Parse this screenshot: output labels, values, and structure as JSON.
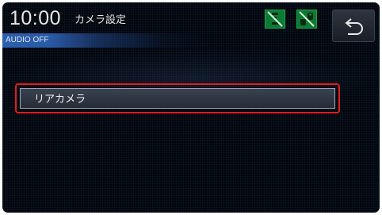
{
  "header": {
    "clock": "10:00",
    "title": "カメラ設定",
    "audio_status": "AUDIO OFF"
  },
  "status_icons": [
    {
      "name": "sensor-off-icon",
      "color": "#0c7a34"
    },
    {
      "name": "parking-sensor-off-icon",
      "color": "#0c7a34"
    }
  ],
  "back_button": {
    "icon": "back-arrow-icon"
  },
  "menu": {
    "items": [
      {
        "label": "リアカメラ",
        "selected": true
      }
    ]
  },
  "colors": {
    "background": "#02060d",
    "selection_outline": "#e21b1b",
    "audio_bar": "#2c5fb0",
    "status_icon_green": "#0c7a34"
  }
}
